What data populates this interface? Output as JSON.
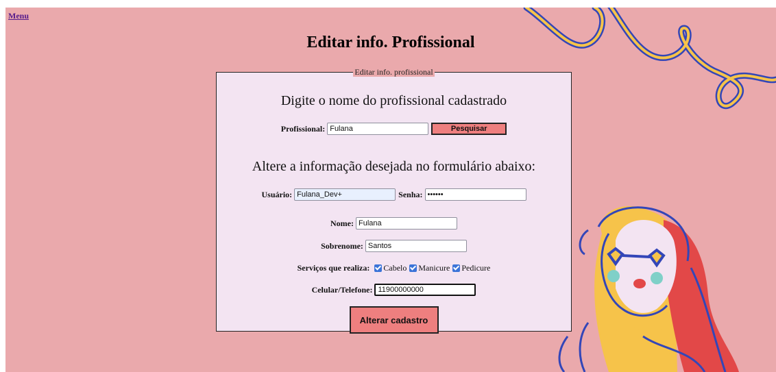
{
  "nav": {
    "menu_label": "Menu"
  },
  "page": {
    "title": "Editar info. Profissional"
  },
  "form": {
    "legend": "Editar info. profissional",
    "search_heading": "Digite o nome do profissional cadastrado",
    "profissional_label": "Profissional:",
    "profissional_value": "Fulana",
    "search_button": "Pesquisar",
    "edit_heading": "Altere a informação desejada no formulário abaixo:",
    "usuario_label": "Usuário:",
    "usuario_value": "Fulana_Dev+",
    "senha_label": "Senha:",
    "senha_value": "••••••",
    "nome_label": "Nome:",
    "nome_value": "Fulana",
    "sobrenome_label": "Sobrenome:",
    "sobrenome_value": "Santos",
    "servicos_label": "Serviços que realiza:",
    "servicos": [
      {
        "label": "Cabelo",
        "checked": true
      },
      {
        "label": "Manicure",
        "checked": true
      },
      {
        "label": "Pedicure",
        "checked": true
      }
    ],
    "telefone_label": "Celular/Telefone:",
    "telefone_value": "11900000000",
    "submit_button": "Alterar cadastro"
  },
  "colors": {
    "background": "#eaa9ac",
    "form_background": "#f3e4f2",
    "button": "#ee7f7f",
    "deco_yellow": "#f6c34a",
    "deco_blue": "#3346b8",
    "hair_red": "#e24848"
  }
}
